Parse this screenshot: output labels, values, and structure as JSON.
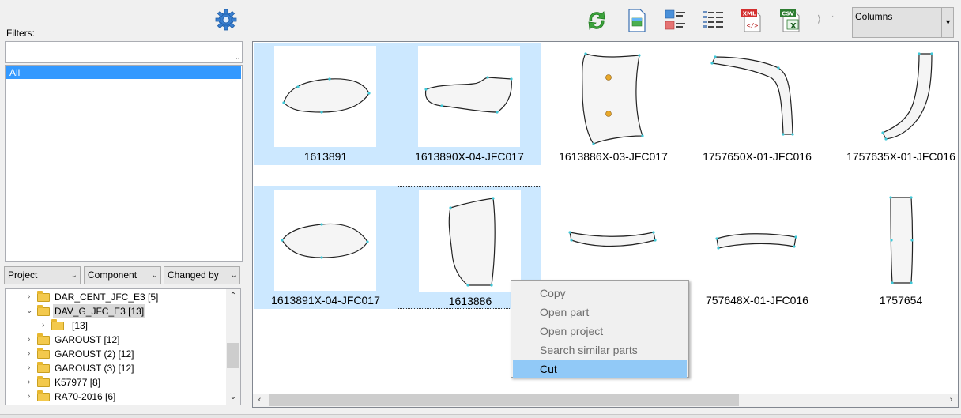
{
  "filters": {
    "label": "Filters:",
    "input_value": "",
    "list_items": [
      "All"
    ]
  },
  "group_by": {
    "combos": [
      "Project",
      "Component",
      "Changed by"
    ]
  },
  "tree": {
    "items": [
      {
        "label": "DAR_CENT_JFC_E3 [5]",
        "expanded": false,
        "selected": false
      },
      {
        "label": "DAV_G_JFC_E3 [13]",
        "expanded": true,
        "selected": true
      },
      {
        "label": "[13]",
        "expanded": false,
        "selected": false
      },
      {
        "label": "GAROUST [12]",
        "expanded": false,
        "selected": false
      },
      {
        "label": "GAROUST (2) [12]",
        "expanded": false,
        "selected": false
      },
      {
        "label": "GAROUST (3) [12]",
        "expanded": false,
        "selected": false
      },
      {
        "label": "K57977 [8]",
        "expanded": false,
        "selected": false
      },
      {
        "label": "RA70-2016 [6]",
        "expanded": false,
        "selected": false
      }
    ]
  },
  "toolbar": {
    "icons": [
      "settings-gear-icon",
      "refresh-icon",
      "image-file-icon",
      "details-view-icon",
      "list-view-icon",
      "export-xml-icon",
      "export-csv-icon"
    ],
    "xml_text": "XML",
    "csv_text": "CSV",
    "view_mode": "Columns"
  },
  "parts": [
    {
      "label": "1613891",
      "selected": true,
      "focused": false
    },
    {
      "label": "1613890X-04-JFC017",
      "selected": true,
      "focused": false
    },
    {
      "label": "1613886X-03-JFC017",
      "selected": false,
      "focused": false
    },
    {
      "label": "1757650X-01-JFC016",
      "selected": false,
      "focused": false
    },
    {
      "label": "1757635X-01-JFC016",
      "selected": false,
      "focused": false
    },
    {
      "label": "1613891X-04-JFC017",
      "selected": true,
      "focused": false
    },
    {
      "label": "1613886",
      "selected": true,
      "focused": true
    },
    {
      "label": "",
      "selected": false,
      "focused": false
    },
    {
      "label": "757648X-01-JFC016",
      "selected": false,
      "focused": false
    },
    {
      "label": "1757654",
      "selected": false,
      "focused": false
    }
  ],
  "context_menu": {
    "items": [
      {
        "label": "Copy",
        "enabled": false
      },
      {
        "label": "Open part",
        "enabled": false
      },
      {
        "label": "Open project",
        "enabled": false
      },
      {
        "label": "Search similar parts",
        "enabled": false
      },
      {
        "label": "Cut",
        "enabled": true,
        "highlighted": true
      }
    ]
  },
  "colors": {
    "selection": "#3399ff",
    "thumb_selected_bg": "#cce8ff",
    "menu_highlight": "#91c9f7",
    "part_fill": "#f5f5f5",
    "part_outline": "#222222",
    "vertex": "#3ec8d8",
    "hole": "#e8a82a"
  }
}
